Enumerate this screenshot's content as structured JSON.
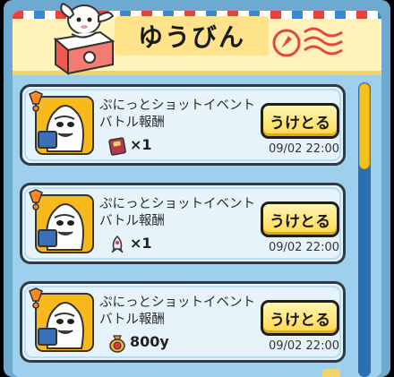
{
  "header": {
    "title": "ゆうびん"
  },
  "mail_items": [
    {
      "title_line1": "ぷにっとショットイベント",
      "title_line2": "バトル報酬",
      "reward_icon": "book-item-icon",
      "quantity": "×1",
      "button_label": "うけとる",
      "date": "09/02 22:00"
    },
    {
      "title_line1": "ぷにっとショットイベント",
      "title_line2": "バトル報酬",
      "reward_icon": "rocket-item-icon",
      "quantity": "×1",
      "button_label": "うけとる",
      "date": "09/02 22:00"
    },
    {
      "title_line1": "ぷにっとショットイベント",
      "title_line2": "バトル報酬",
      "reward_icon": "money-bag-icon",
      "quantity": "800y",
      "button_label": "うけとる",
      "date": "09/02 22:00"
    }
  ],
  "colors": {
    "panel": "#9ed0ee",
    "button": "#ffd94a",
    "scroll_thumb": "#f5c21b"
  }
}
